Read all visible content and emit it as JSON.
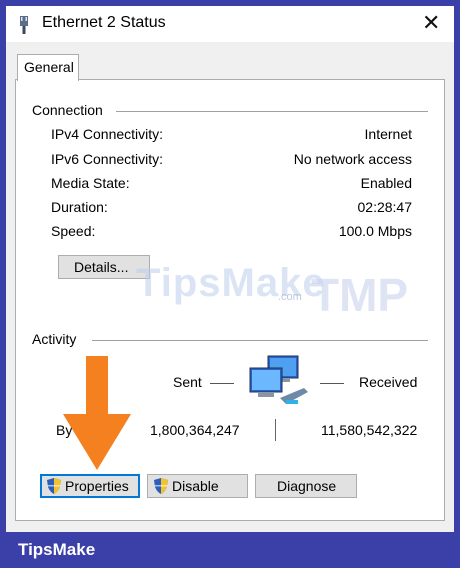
{
  "window": {
    "title": "Ethernet 2 Status",
    "close_glyph": "✕"
  },
  "tabs": [
    {
      "label": "General"
    }
  ],
  "connection": {
    "group_label": "Connection",
    "rows": [
      {
        "label": "IPv4 Connectivity:",
        "value": "Internet"
      },
      {
        "label": "IPv6 Connectivity:",
        "value": "No network access"
      },
      {
        "label": "Media State:",
        "value": "Enabled"
      },
      {
        "label": "Duration:",
        "value": "02:28:47"
      },
      {
        "label": "Speed:",
        "value": "100.0 Mbps"
      }
    ],
    "details_button": "Details..."
  },
  "activity": {
    "group_label": "Activity",
    "sent_label": "Sent",
    "received_label": "Received",
    "bytes_label": "By",
    "sent_bytes": "1,800,364,247",
    "received_bytes": "11,580,542,322",
    "network_icon": "network-computers-icon"
  },
  "buttons": {
    "properties": "Properties",
    "disable": "Disable",
    "diagnose": "Diagnose",
    "shield_icon": "uac-shield-icon"
  },
  "watermark": {
    "text": "TipsMake",
    "suffix": ".com",
    "mark": "TMP"
  },
  "overlay": {
    "arrow_color": "#f4801f",
    "arrow_icon": "arrow-down-icon"
  },
  "brand": {
    "label": "TipsMake",
    "bar_color": "#3b3fa8"
  }
}
